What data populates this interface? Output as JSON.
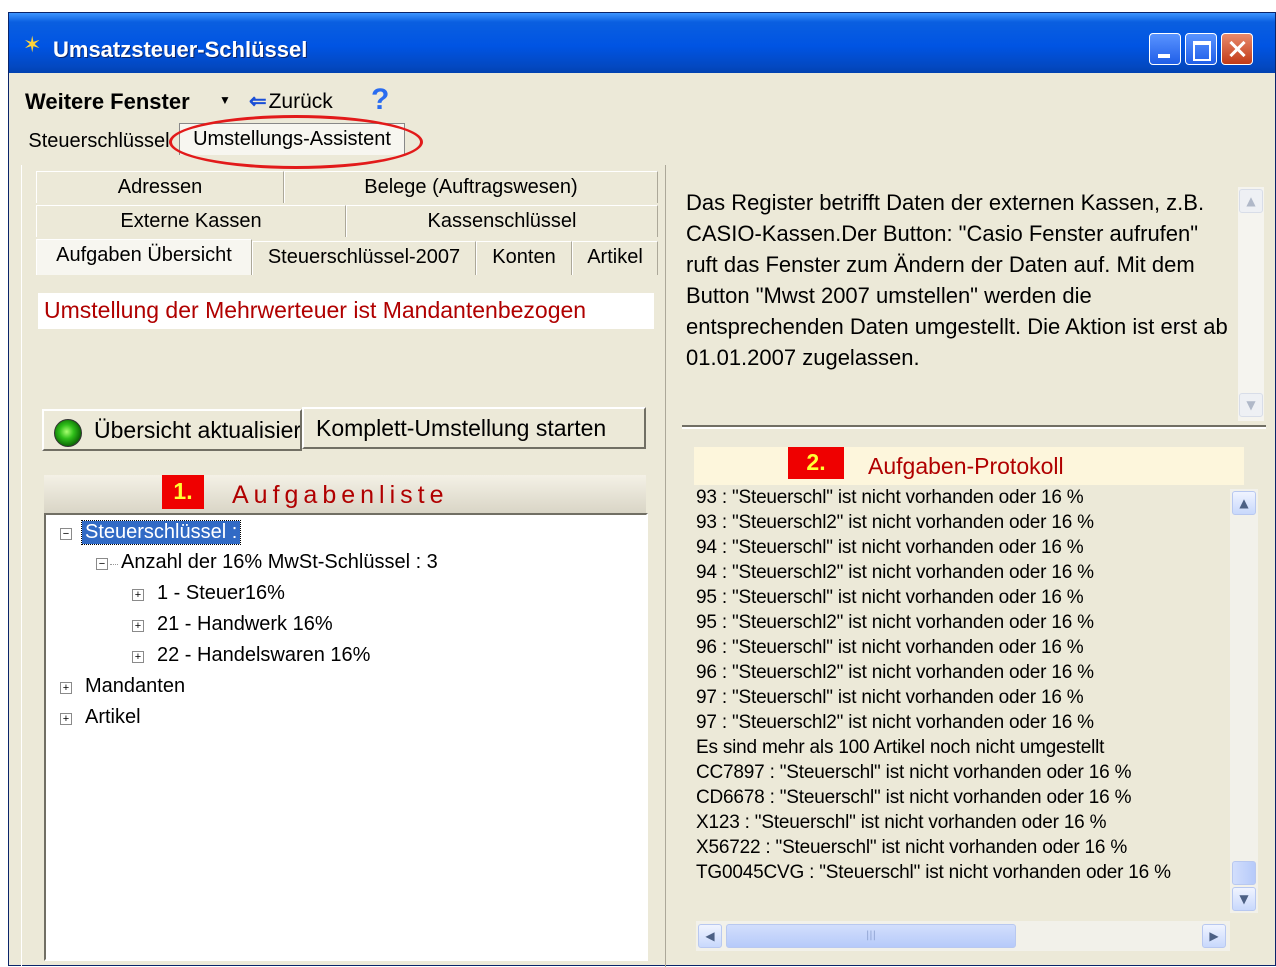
{
  "window": {
    "title": "Umsatzsteuer-Schlüssel",
    "icon": "wand-icon"
  },
  "toolbar": {
    "menu_label": "Weitere Fenster",
    "back_label": "Zurück",
    "help_symbol": "?"
  },
  "outer_tabs": [
    {
      "label": "Steuerschlüssel"
    },
    {
      "label": "Umstellungs-Assistent",
      "active": true
    }
  ],
  "inner_tabs": {
    "row1": [
      "Adressen",
      "Belege (Auftragswesen)"
    ],
    "row2": [
      "Externe Kassen",
      "Kassenschlüssel"
    ],
    "row3": [
      "Aufgaben Übersicht",
      "Steuerschlüssel-2007",
      "Konten",
      "Artikel"
    ]
  },
  "left": {
    "banner": "Umstellung der Mehrwerteuer ist Mandantenbezogen",
    "refresh_button": "Übersicht aktualisieren",
    "start_button": "Komplett-Umstellung starten",
    "list_badge": "1.",
    "list_title": "Aufgabenliste",
    "tree": [
      {
        "label": "Steuerschlüssel :",
        "toggle": "−",
        "selected": true
      },
      {
        "label": "Anzahl der 16% MwSt-Schlüssel : 3",
        "toggle": "−"
      },
      {
        "label": "1 - Steuer16%",
        "toggle": "+"
      },
      {
        "label": "21 - Handwerk 16%",
        "toggle": "+"
      },
      {
        "label": "22 - Handelswaren 16%",
        "toggle": "+"
      },
      {
        "label": "Mandanten",
        "toggle": "+"
      },
      {
        "label": "Artikel",
        "toggle": "+"
      }
    ]
  },
  "right": {
    "info_text": "Das Register betrifft Daten der externen Kassen, z.B. CASIO-Kassen.Der Button: \"Casio Fenster aufrufen\" ruft das Fenster zum Ändern der Daten auf. Mit dem Button \"Mwst 2007 umstellen\" werden die entsprechenden Daten umgestellt. Die Aktion ist erst ab 01.01.2007 zugelassen.",
    "protocol_badge": "2.",
    "protocol_title": "Aufgaben-Protokoll",
    "protocol_lines": [
      "93 : \"Steuerschl\"  ist nicht vorhanden oder 16 %",
      "93 : \"Steuerschl2\" ist nicht vorhanden oder 16 %",
      "94 : \"Steuerschl\"  ist nicht vorhanden oder 16 %",
      "94 : \"Steuerschl2\" ist nicht vorhanden oder 16 %",
      "95 : \"Steuerschl\"  ist nicht vorhanden oder 16 %",
      "95 : \"Steuerschl2\" ist nicht vorhanden oder 16 %",
      "96 : \"Steuerschl\"  ist nicht vorhanden oder 16 %",
      "96 : \"Steuerschl2\" ist nicht vorhanden oder 16 %",
      "97 : \"Steuerschl\"  ist nicht vorhanden oder 16 %",
      "97 : \"Steuerschl2\" ist nicht vorhanden oder 16 %",
      "Es sind mehr als 100 Artikel noch nicht umgestellt",
      "CC7897 : \"Steuerschl\"  ist nicht vorhanden oder 16 %",
      "CD6678 : \"Steuerschl\"  ist nicht vorhanden oder 16 %",
      "X123 : \"Steuerschl\"  ist nicht vorhanden oder 16 %",
      "X56722 : \"Steuerschl\"  ist nicht vorhanden oder 16 %",
      "TG0045CVG : \"Steuerschl\"  ist nicht vorhanden oder 16 %"
    ]
  },
  "colors": {
    "titlebar": "#0054e3",
    "annotation_red": "#e21a1a",
    "badge_red": "#ef0000",
    "badge_text": "#ffff33",
    "banner_text": "#b00000",
    "selection": "#316ac5"
  }
}
